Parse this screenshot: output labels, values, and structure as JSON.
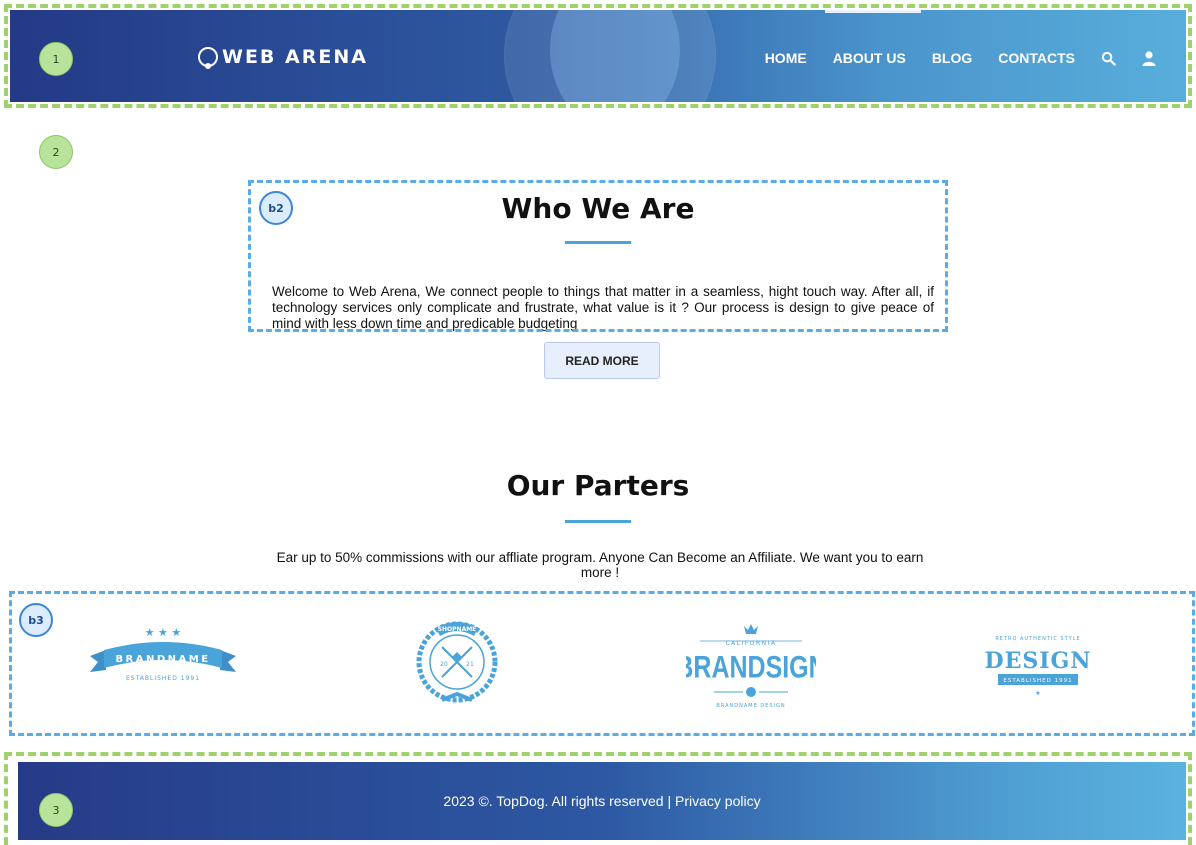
{
  "colors": {
    "header_gradient_start": "#243a86",
    "header_gradient_end": "#58aedb",
    "accent": "#4aa3d9",
    "annotation_green": "#9fd26b",
    "annotation_blue": "#5aabe6"
  },
  "markers": {
    "m1": "1",
    "m2": "2",
    "m3": "3",
    "b2": "b2",
    "b3": "b3"
  },
  "header": {
    "logo_text": "WEB ARENA",
    "nav": {
      "home": "HOME",
      "about": "ABOUT US",
      "blog": "BLOG",
      "contacts": "CONTACTS"
    },
    "icons": [
      "search-icon",
      "user-icon"
    ]
  },
  "who": {
    "title": "Who We Are",
    "body": "Welcome to Web Arena, We connect people to things that matter in a seamless, hight touch way. After all, if technology services only complicate and frustrate, what value is it ? Our process is design to give peace of mind with less down time and predicable budgeting",
    "button": "READ MORE"
  },
  "partners": {
    "title": "Our Parters",
    "body": "Ear up to 50% commissions with our affliate program. Anyone Can Become an Affiliate. We want you to earn more !",
    "logos": {
      "l1_main": "BRANDNAME",
      "l1_sub": "ESTABLISHED 1991",
      "l2_top": "SHOPNAME",
      "l2_left": "20",
      "l2_right": "21",
      "l3_top": "CALIFORNIA",
      "l3_main": "BRANDSIGN",
      "l3_bottom": "BRANDNAME DESIGN",
      "l4_top": "RETRO AUTHENTIC STYLE",
      "l4_main": "DESIGN",
      "l4_sub": "ESTABLISHED 1991"
    }
  },
  "footer": {
    "text": "2023 ©. TopDog. All rights reserved | Privacy policy"
  }
}
